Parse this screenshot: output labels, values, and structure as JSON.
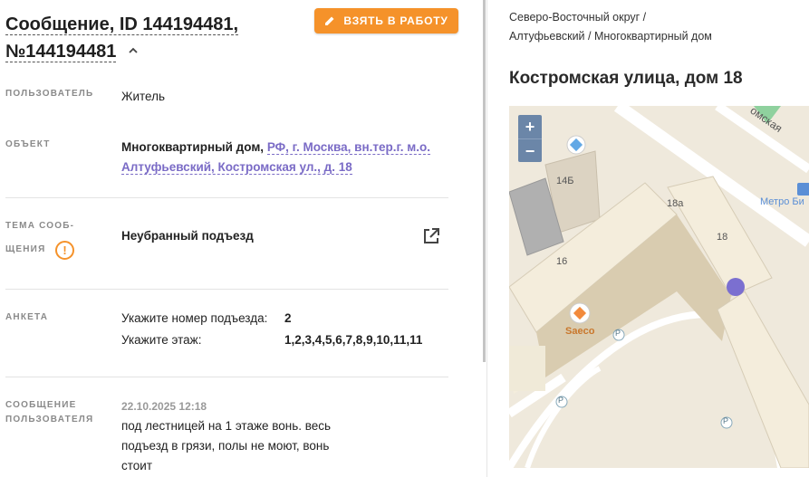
{
  "header": {
    "title": "Сообщение, ID 144194481, №144194481",
    "take_button": "ВЗЯТЬ В РАБОТУ"
  },
  "fields": {
    "user_label": "ПОЛЬЗОВАТЕЛЬ",
    "user_value": "Житель",
    "object_label": "ОБЪЕКТ",
    "object_type": "Многоквартирный дом,",
    "object_link_1": "РФ, г. Москва, вн.тер.г. м.о.",
    "object_link_2": "Алтуфьевский, Костромская ул., д. 18",
    "topic_label_1": "ТЕМА СООБ-",
    "topic_label_2": "ЩЕНИЯ",
    "topic_value": "Неубранный подъезд",
    "survey_label": "АНКЕТА",
    "survey_q1": "Укажите номер подъезда:",
    "survey_a1": "2",
    "survey_q2": "Укажите этаж:",
    "survey_a2": "1,2,3,4,5,6,7,8,9,10,11,11",
    "message_label_1": "СООБЩЕНИЕ",
    "message_label_2": "ПОЛЬЗОВАТЕЛЯ",
    "message_date": "22.10.2025 12:18",
    "message_text": "под лестницей на 1 этаже вонь. весь подъезд в грязи, полы не моют, вонь стоит"
  },
  "right": {
    "breadcrumb_1": "Северо-Восточный округ /",
    "breadcrumb_2": "Алтуфьевский / Многоквартирный дом",
    "address": "Костромская улица, дом 18"
  },
  "map": {
    "zoom_in": "+",
    "zoom_out": "−",
    "street": "омская",
    "b14": "14Б",
    "b18a": "18а",
    "b18": "18",
    "b16": "16",
    "metro": "Метро Би",
    "poi": "Saeco",
    "parking": "P"
  },
  "colors": {
    "accent": "#f5922a",
    "link": "#7a6bc6",
    "marker": "#7b6fd0"
  }
}
